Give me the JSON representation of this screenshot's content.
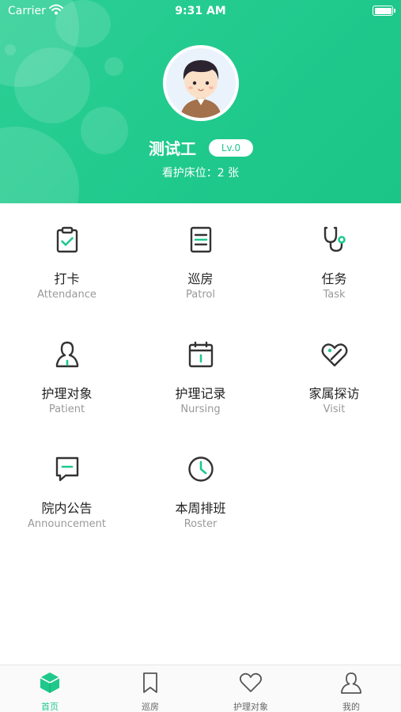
{
  "status_bar": {
    "carrier": "Carrier",
    "time": "9:31 AM"
  },
  "profile": {
    "name": "测试工",
    "level": "Lv.0",
    "beds": "看护床位：2 张"
  },
  "menu": [
    {
      "cn": "打卡",
      "en": "Attendance",
      "icon": "clipboard-check-icon"
    },
    {
      "cn": "巡房",
      "en": "Patrol",
      "icon": "document-icon"
    },
    {
      "cn": "任务",
      "en": "Task",
      "icon": "stethoscope-icon"
    },
    {
      "cn": "护理对象",
      "en": "Patient",
      "icon": "person-icon"
    },
    {
      "cn": "护理记录",
      "en": "Nursing",
      "icon": "calendar-icon"
    },
    {
      "cn": "家属探访",
      "en": "Visit",
      "icon": "heart-tag-icon"
    },
    {
      "cn": "院内公告",
      "en": "Announcement",
      "icon": "message-icon"
    },
    {
      "cn": "本周排班",
      "en": "Roster",
      "icon": "clock-icon"
    }
  ],
  "tabs": [
    {
      "label": "首页",
      "icon": "home-cube-icon",
      "active": true
    },
    {
      "label": "巡房",
      "icon": "bookmark-icon",
      "active": false
    },
    {
      "label": "护理对象",
      "icon": "heart-icon",
      "active": false
    },
    {
      "label": "我的",
      "icon": "user-icon",
      "active": false
    }
  ],
  "colors": {
    "accent": "#1fc98c",
    "icon_stroke": "#333333"
  }
}
